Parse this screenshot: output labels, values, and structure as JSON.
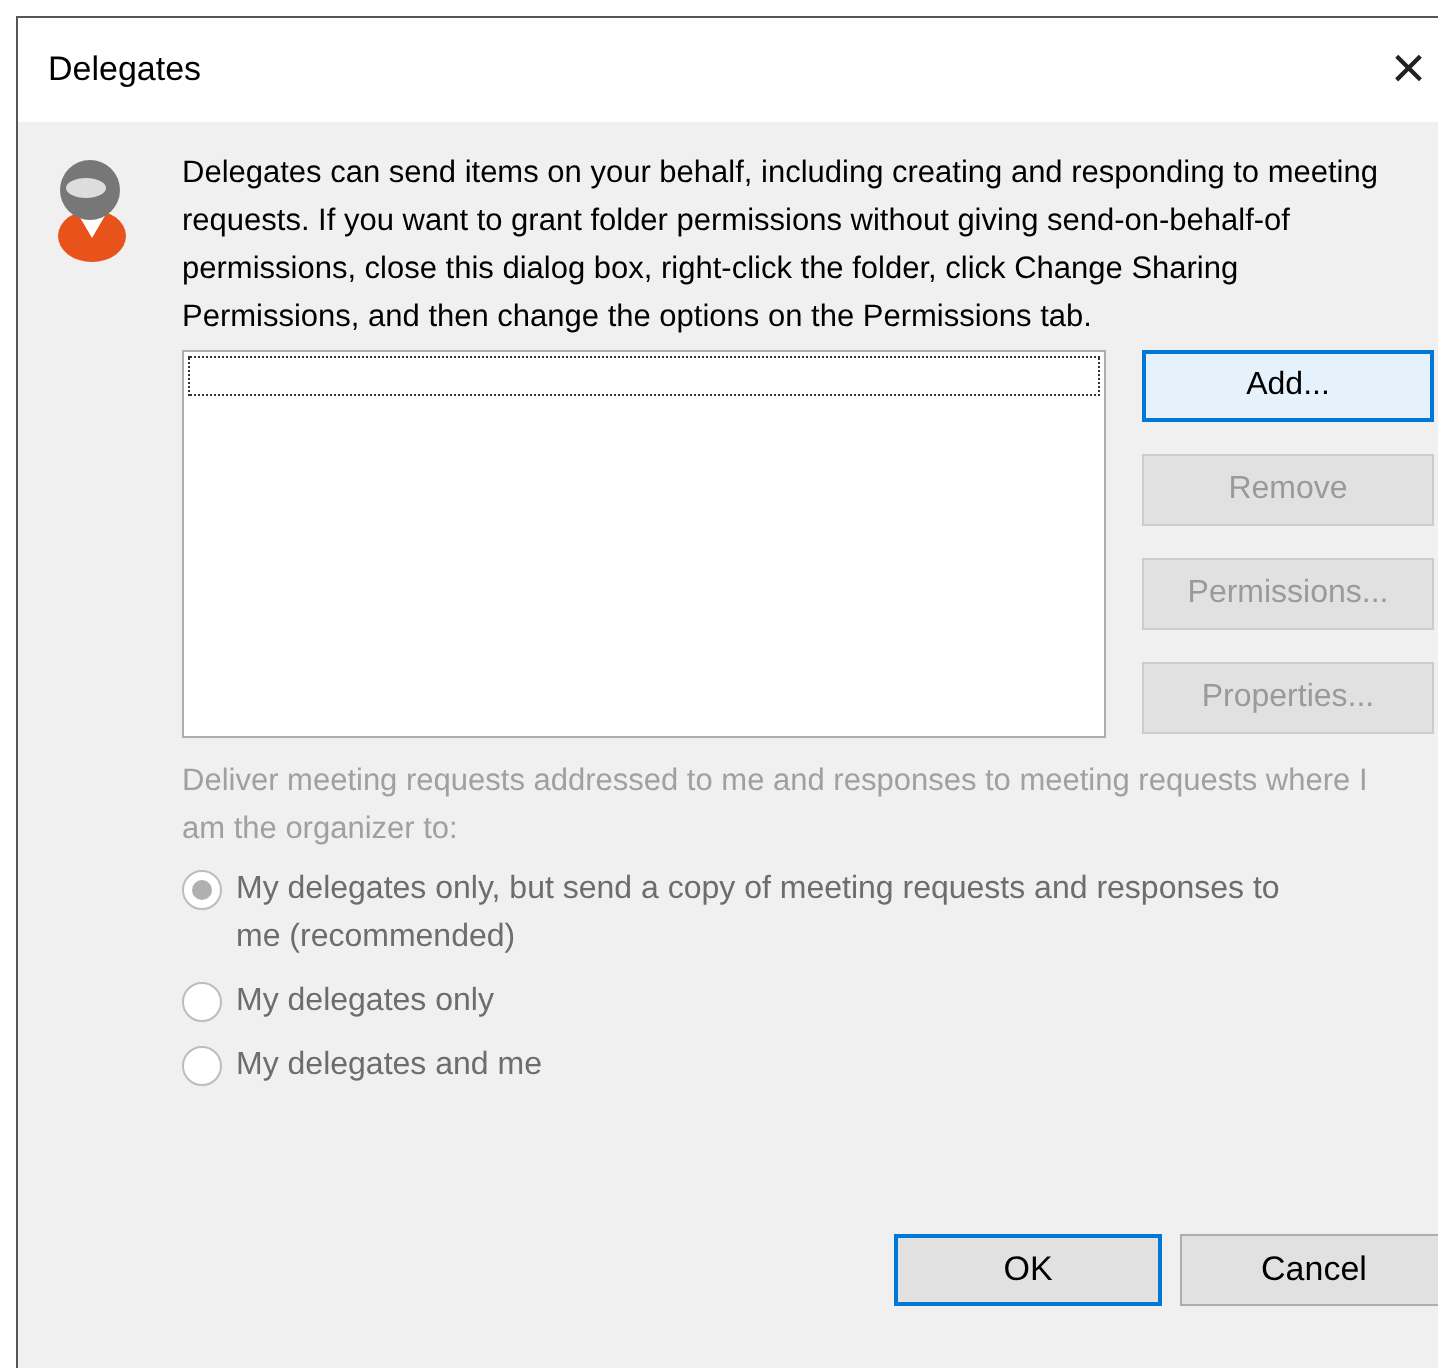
{
  "window": {
    "title": "Delegates",
    "close": "×"
  },
  "intro": "Delegates can send items on your behalf, including creating and responding to meeting requests. If you want to grant folder permissions without giving send-on-behalf-of permissions, close this dialog box, right-click the folder, click Change Sharing Permissions, and then change the options on the Permissions tab.",
  "side_buttons": [
    {
      "label": "Add...",
      "disabled": false,
      "focused": true
    },
    {
      "label": "Remove",
      "disabled": true,
      "focused": false
    },
    {
      "label": "Permissions...",
      "disabled": true,
      "focused": false
    },
    {
      "label": "Properties...",
      "disabled": true,
      "focused": false
    }
  ],
  "delivery": {
    "label": "Deliver meeting requests addressed to me and responses to meeting requests where I am the organizer to:",
    "disabled": true,
    "options": [
      {
        "label": "My delegates only, but send a copy of meeting requests and responses to me (recommended)",
        "selected": true
      },
      {
        "label": "My delegates only",
        "selected": false
      },
      {
        "label": "My delegates and me",
        "selected": false
      }
    ]
  },
  "footer_buttons": [
    {
      "label": "OK",
      "focused": true
    },
    {
      "label": "Cancel",
      "focused": false
    }
  ]
}
